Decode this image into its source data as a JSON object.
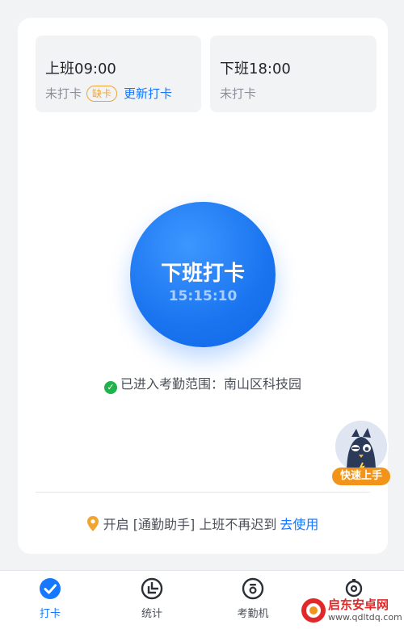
{
  "shifts": {
    "on": {
      "title": "上班09:00",
      "status": "未打卡",
      "badge": "缺卡",
      "action": "更新打卡"
    },
    "off": {
      "title": "下班18:00",
      "status": "未打卡"
    }
  },
  "clock_button": {
    "label": "下班打卡",
    "time": "15:15:10"
  },
  "range": {
    "text": "已进入考勤范围：南山区科技园"
  },
  "helper": {
    "text": "开启 [通勤助手] 上班不再迟到",
    "link": "去使用"
  },
  "assistant": {
    "label": "快速上手"
  },
  "tabs": [
    {
      "label": "打卡",
      "icon": "check-circle-icon",
      "active": true
    },
    {
      "label": "统计",
      "icon": "pie-chart-icon",
      "active": false
    },
    {
      "label": "考勤机",
      "icon": "attendance-machine-icon",
      "active": false
    },
    {
      "label": "",
      "icon": "settings-icon",
      "active": false
    }
  ],
  "watermark": {
    "title": "启东安卓网",
    "url": "www.qdltdq.com"
  },
  "colors": {
    "accent": "#1677ff",
    "warning": "#f0a431",
    "success": "#22b24c",
    "assistant": "#f29419"
  }
}
